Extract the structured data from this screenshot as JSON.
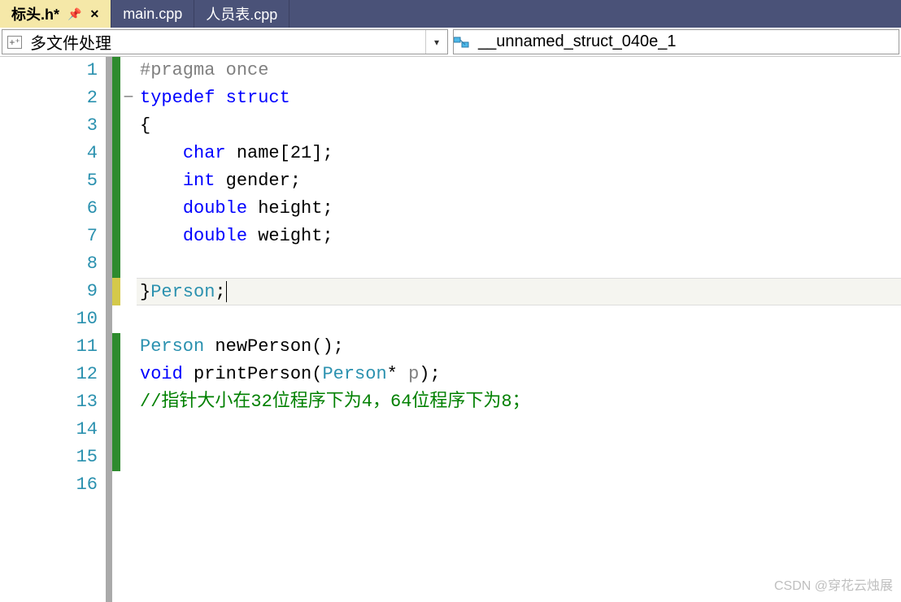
{
  "tabs": [
    {
      "label": "标头.h*",
      "active": true,
      "pinned": true,
      "closeable": true
    },
    {
      "label": "main.cpp",
      "active": false
    },
    {
      "label": "人员表.cpp",
      "active": false
    }
  ],
  "nav": {
    "scope": "多文件处理",
    "member": "__unnamed_struct_040e_1"
  },
  "code_lines": [
    {
      "n": 1,
      "bar": "green",
      "fold": "",
      "tokens": [
        {
          "t": "#pragma once",
          "c": "pragma"
        }
      ]
    },
    {
      "n": 2,
      "bar": "green",
      "fold": "−",
      "tokens": [
        {
          "t": "typedef",
          "c": "kw"
        },
        {
          "t": " ",
          "c": "txt"
        },
        {
          "t": "struct",
          "c": "kw"
        }
      ]
    },
    {
      "n": 3,
      "bar": "green",
      "fold": "",
      "tokens": [
        {
          "t": "{",
          "c": "punct"
        }
      ]
    },
    {
      "n": 4,
      "bar": "green",
      "fold": "",
      "tokens": [
        {
          "t": "    ",
          "c": "txt"
        },
        {
          "t": "char",
          "c": "kw"
        },
        {
          "t": " name[",
          "c": "txt"
        },
        {
          "t": "21",
          "c": "num"
        },
        {
          "t": "];",
          "c": "txt"
        }
      ]
    },
    {
      "n": 5,
      "bar": "green",
      "fold": "",
      "tokens": [
        {
          "t": "    ",
          "c": "txt"
        },
        {
          "t": "int",
          "c": "kw"
        },
        {
          "t": " gender;",
          "c": "txt"
        }
      ]
    },
    {
      "n": 6,
      "bar": "green",
      "fold": "",
      "tokens": [
        {
          "t": "    ",
          "c": "txt"
        },
        {
          "t": "double",
          "c": "kw"
        },
        {
          "t": " height;",
          "c": "txt"
        }
      ]
    },
    {
      "n": 7,
      "bar": "green",
      "fold": "",
      "tokens": [
        {
          "t": "    ",
          "c": "txt"
        },
        {
          "t": "double",
          "c": "kw"
        },
        {
          "t": " weight;",
          "c": "txt"
        }
      ]
    },
    {
      "n": 8,
      "bar": "green",
      "fold": "",
      "tokens": []
    },
    {
      "n": 9,
      "bar": "yellow",
      "fold": "",
      "current": true,
      "tokens": [
        {
          "t": "}",
          "c": "punct"
        },
        {
          "t": "Person",
          "c": "type"
        },
        {
          "t": ";",
          "c": "punct"
        }
      ],
      "cursor": true
    },
    {
      "n": 10,
      "bar": "",
      "fold": "",
      "tokens": []
    },
    {
      "n": 11,
      "bar": "green",
      "fold": "",
      "tokens": [
        {
          "t": "Person",
          "c": "type"
        },
        {
          "t": " newPerson();",
          "c": "txt"
        }
      ]
    },
    {
      "n": 12,
      "bar": "green",
      "fold": "",
      "tokens": [
        {
          "t": "void",
          "c": "kw"
        },
        {
          "t": " printPerson(",
          "c": "txt"
        },
        {
          "t": "Person",
          "c": "type"
        },
        {
          "t": "* ",
          "c": "txt"
        },
        {
          "t": "p",
          "c": "param"
        },
        {
          "t": ");",
          "c": "txt"
        }
      ]
    },
    {
      "n": 13,
      "bar": "green",
      "fold": "",
      "tokens": [
        {
          "t": "//指针大小在32位程序下为4，64位程序下为8；",
          "c": "comment"
        }
      ]
    },
    {
      "n": 14,
      "bar": "green",
      "fold": "",
      "tokens": []
    },
    {
      "n": 15,
      "bar": "green",
      "fold": "",
      "tokens": []
    },
    {
      "n": 16,
      "bar": "",
      "fold": "",
      "tokens": []
    }
  ],
  "watermark": "CSDN @穿花云烛展"
}
